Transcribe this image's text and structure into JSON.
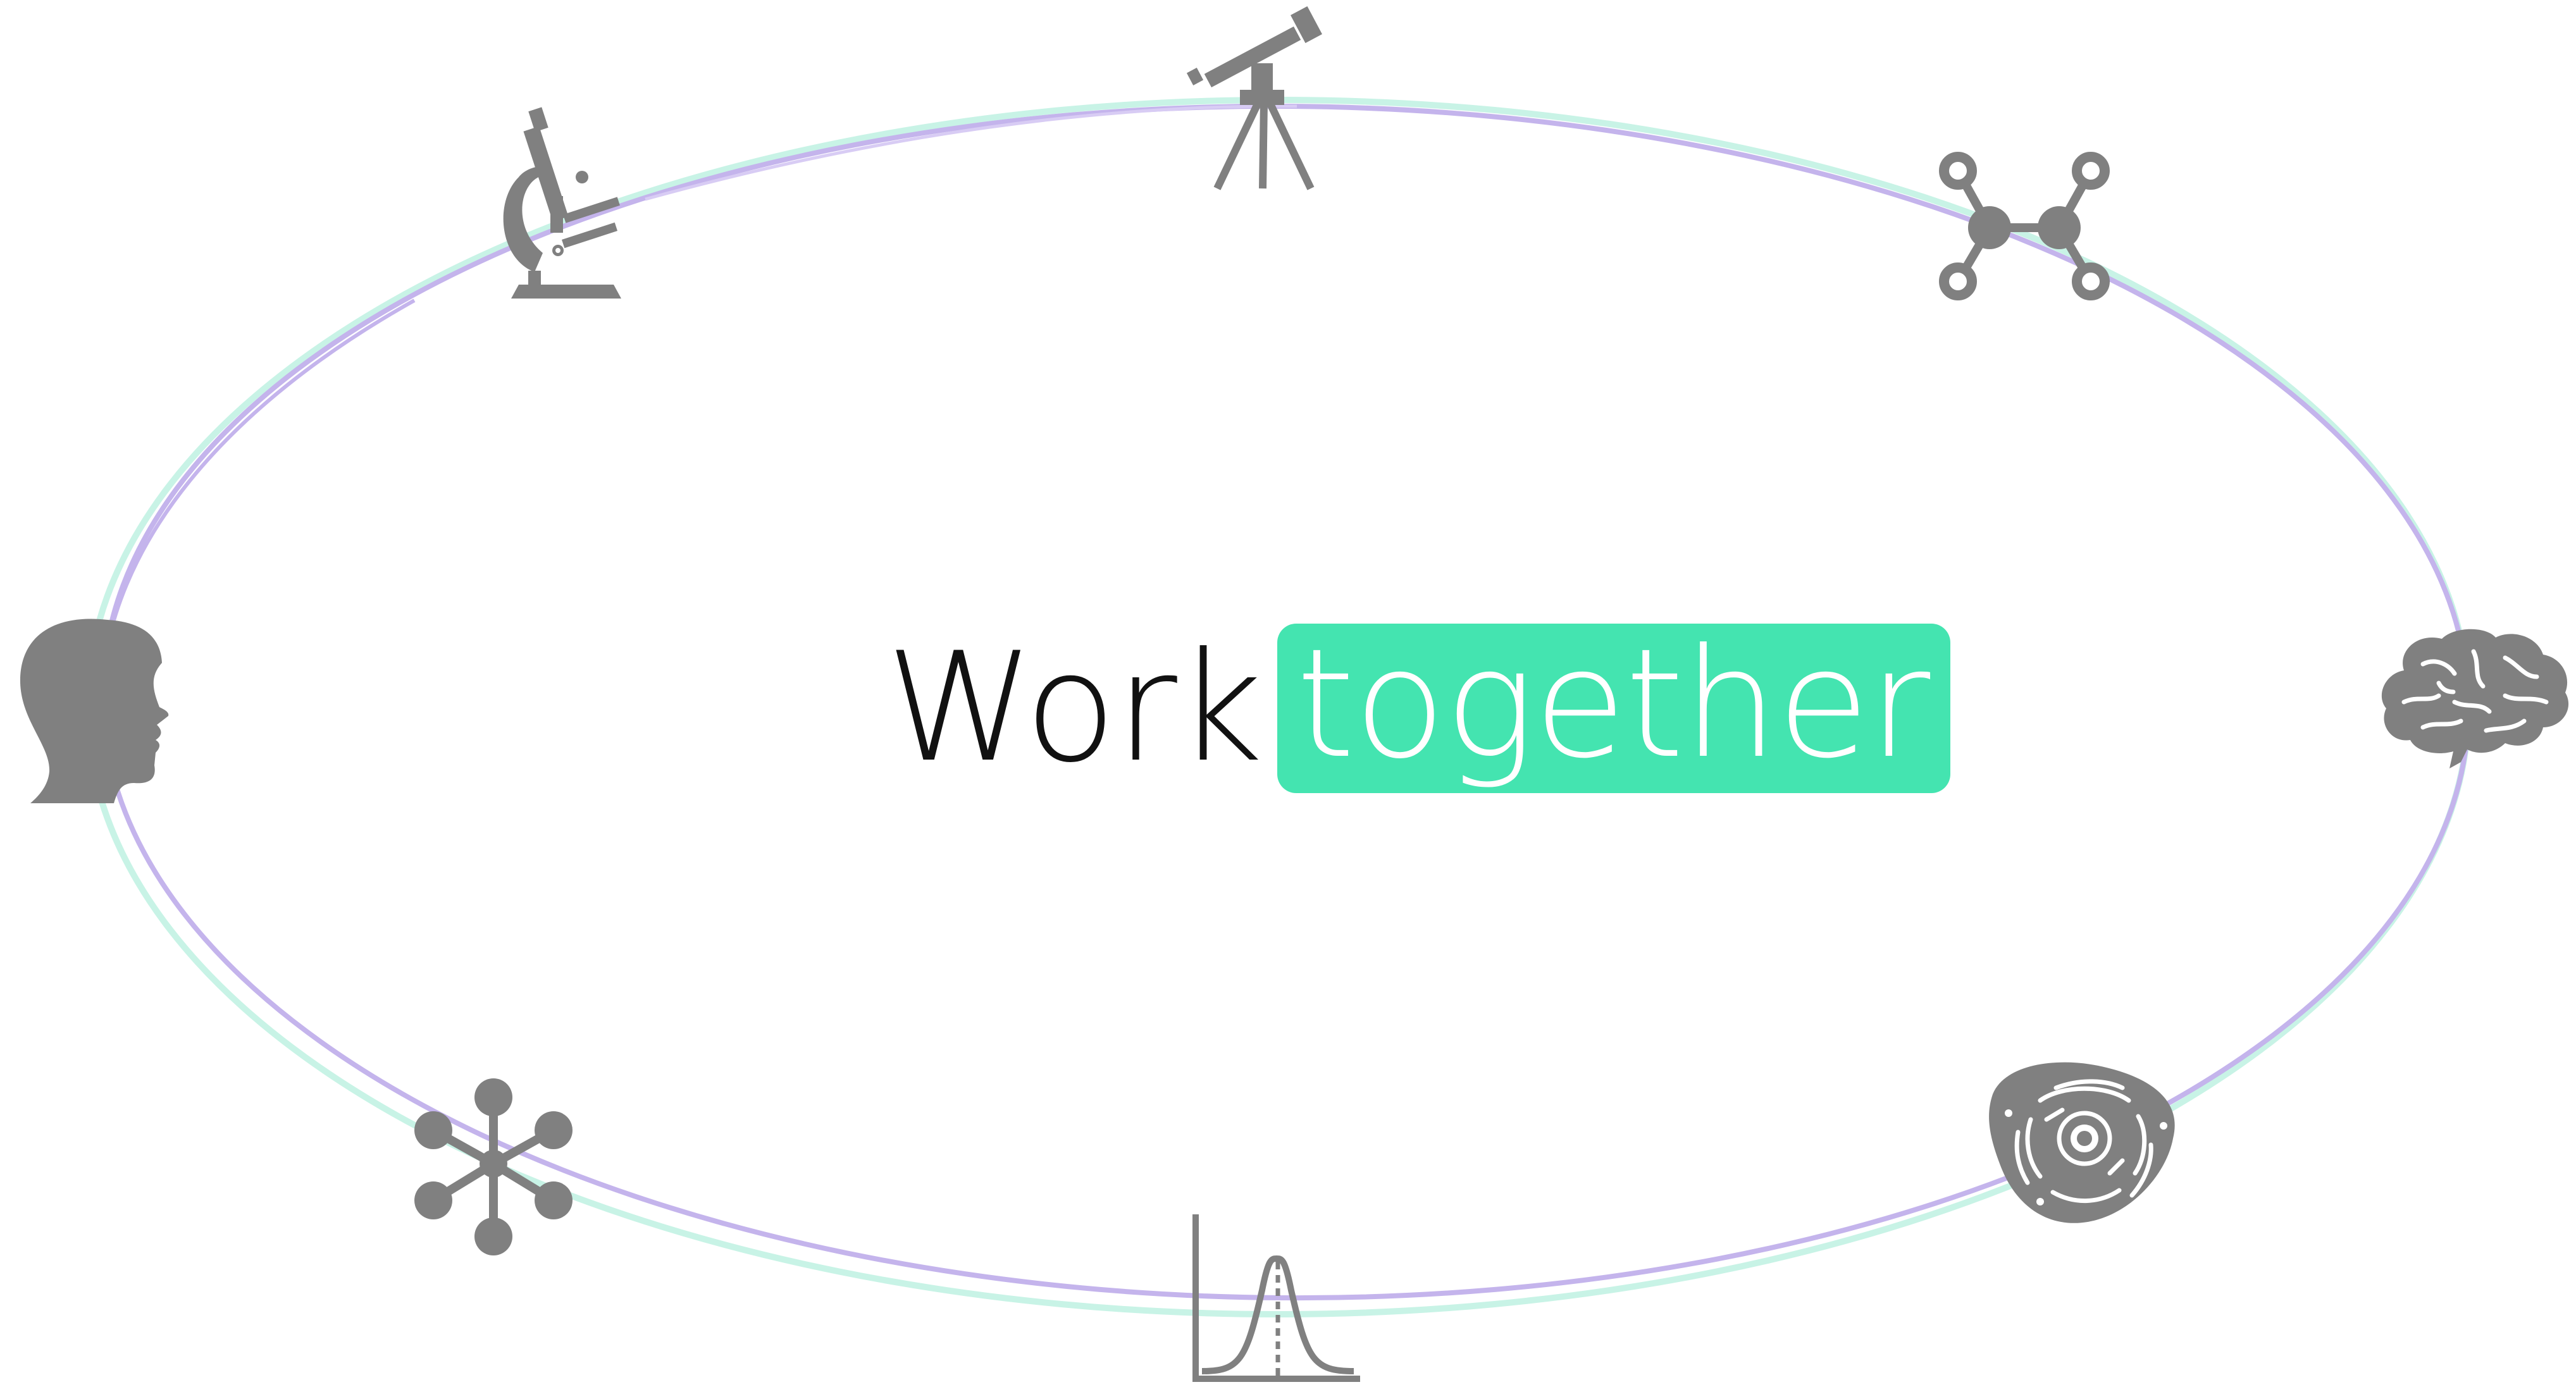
{
  "title": {
    "first_word": "Work",
    "highlight_word": "together"
  },
  "colors": {
    "highlight": "#44e4b0",
    "ring_purple": "#c4b4ec",
    "ring_mint": "#c8f3e6",
    "icon_gray": "#808080"
  },
  "icons": [
    "microscope-icon",
    "telescope-icon",
    "molecule-icon",
    "human-head-icon",
    "brain-icon",
    "network-node-icon",
    "bell-curve-icon",
    "cell-icon"
  ]
}
